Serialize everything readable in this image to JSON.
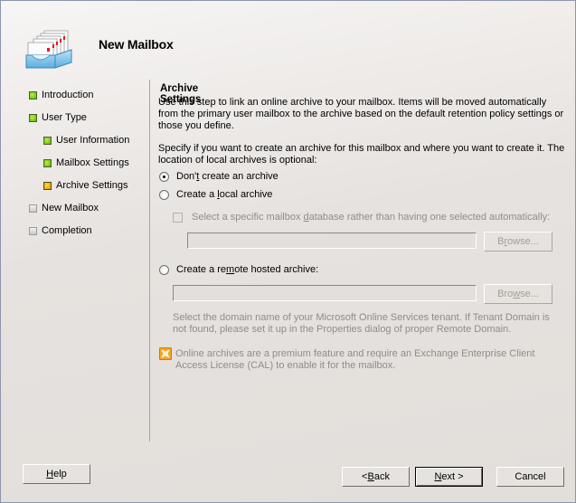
{
  "window": {
    "title": "New Mailbox",
    "header_icon": "mailbox-stack-icon"
  },
  "nav": {
    "items": [
      {
        "label": "Introduction",
        "status": "done",
        "level": 0
      },
      {
        "label": "User Type",
        "status": "done",
        "level": 0
      },
      {
        "label": "User Information",
        "status": "done",
        "level": 1
      },
      {
        "label": "Mailbox Settings",
        "status": "done",
        "level": 1
      },
      {
        "label": "Archive Settings",
        "status": "current",
        "level": 1
      },
      {
        "label": "New Mailbox",
        "status": "pending",
        "level": 0
      },
      {
        "label": "Completion",
        "status": "pending",
        "level": 0
      }
    ]
  },
  "content": {
    "section_title": "Archive Settings",
    "intro": "Use this step to link an online archive to your mailbox. Items will be moved automatically from the primary user mailbox to the archive based on the default retention policy settings or those you define.",
    "specify": "Specify if you want to create an archive for this mailbox and where you want to create it. The location of local archives is optional:",
    "options": {
      "none": {
        "pre": "Don'",
        "accel": "t",
        "post": " create an archive",
        "checked": true
      },
      "local": {
        "pre": "Create a ",
        "accel": "l",
        "post": "ocal archive",
        "checked": false
      },
      "remote": {
        "pre": "Create a re",
        "accel": "m",
        "post": "ote hosted archive:",
        "checked": false
      }
    },
    "db_checkbox": {
      "pre": "Select a specific mailbox ",
      "accel": "d",
      "post": "atabase rather than having one selected automatically:",
      "checked": false,
      "enabled": false
    },
    "local_db_value": "",
    "local_browse": {
      "pre": "B",
      "accel": "r",
      "post": "owse..."
    },
    "remote_domain_value": "",
    "remote_browse": {
      "pre": "Bro",
      "accel": "w",
      "post": "se..."
    },
    "remote_hint": "Select the domain name of your Microsoft Online Services tenant. If Tenant Domain is not found, please set it up in the Properties dialog of proper Remote Domain.",
    "license_note": "Online archives are a premium feature and require an Exchange Enterprise Client Access License (CAL) to enable it for the mailbox."
  },
  "footer": {
    "help": {
      "accel": "H",
      "post": "elp"
    },
    "back": {
      "pre": "< ",
      "accel": "B",
      "post": "ack"
    },
    "next": {
      "accel": "N",
      "post": "ext >"
    },
    "cancel": "Cancel"
  },
  "colors": {
    "done": "#7fd11b",
    "current": "#f2b900",
    "pending": "#d6d6d6",
    "info_icon": "#f5a623"
  }
}
